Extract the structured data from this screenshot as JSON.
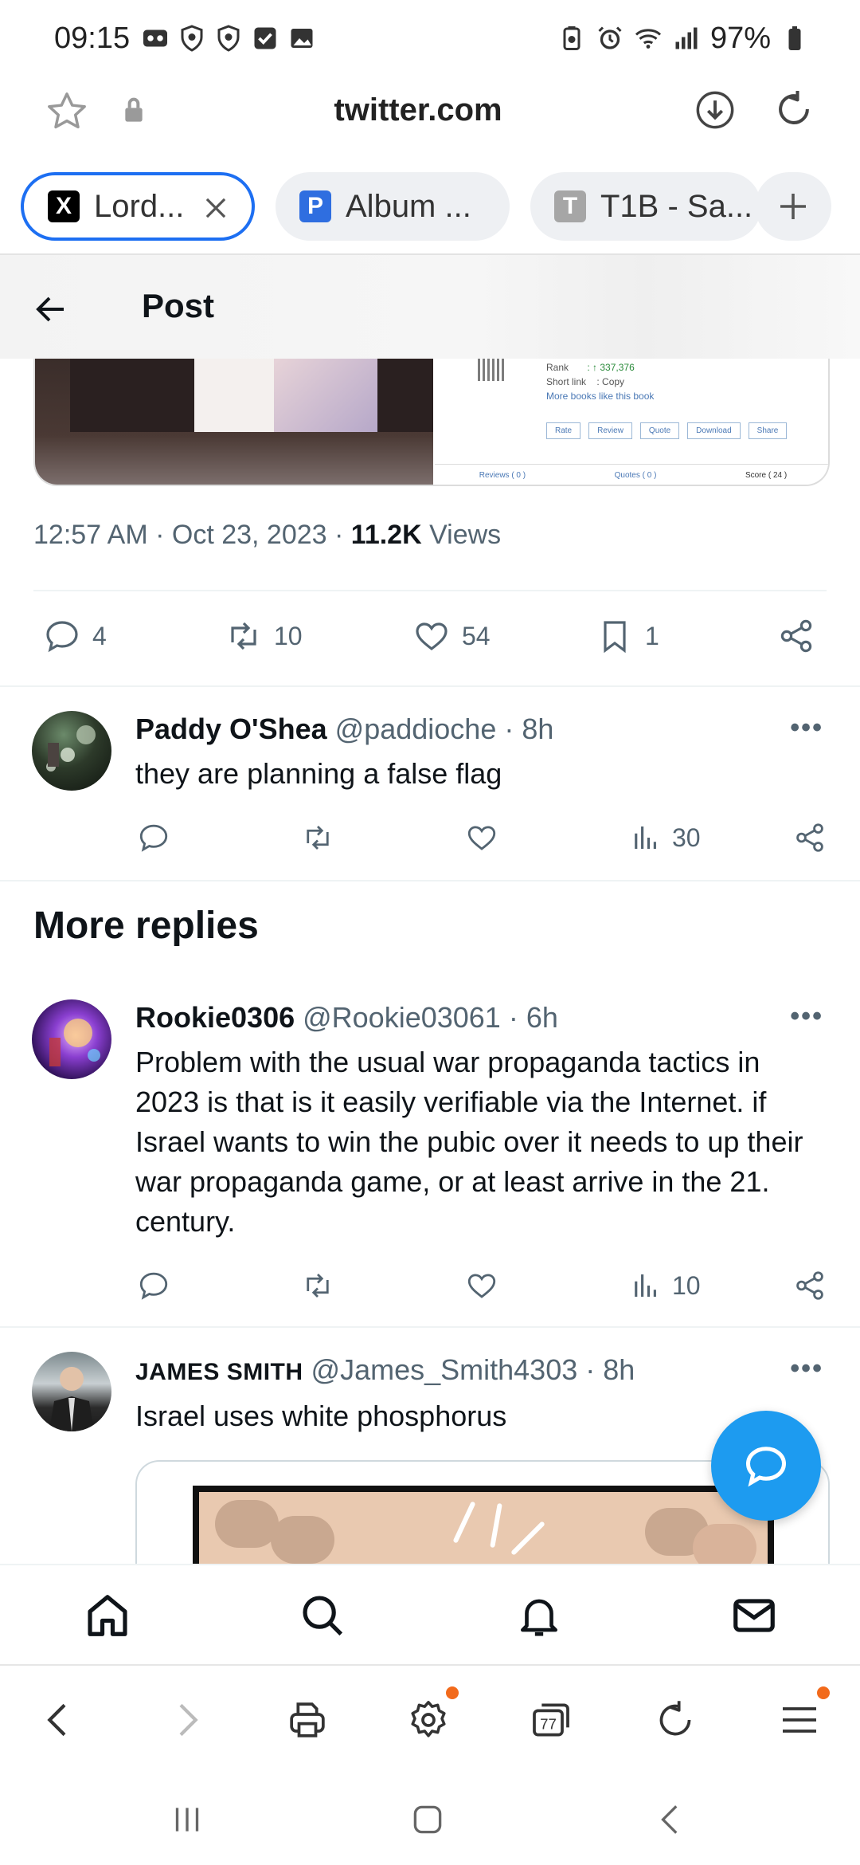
{
  "status_bar": {
    "time": "09:15",
    "battery": "97%"
  },
  "browser": {
    "url": "twitter.com",
    "tabs": [
      {
        "label": "Lord...",
        "favicon": "X",
        "active": true
      },
      {
        "label": "Album ...",
        "favicon": "P",
        "active": false
      },
      {
        "label": "T1B - Sa...",
        "favicon": "T",
        "active": false
      }
    ]
  },
  "post_header": {
    "title": "Post"
  },
  "media_preview": {
    "rank_label": "Rank",
    "rank_value": ": ↑ 337,376",
    "short_link_label": "Short link",
    "short_link_value": ": Copy",
    "more_books": "More books like this book",
    "buttons": [
      "Rate",
      "Review",
      "Quote",
      "Download",
      "Share"
    ],
    "footer": [
      "Reviews ( 0 )",
      "Quotes ( 0 )",
      "Score ( 24 )"
    ]
  },
  "main_tweet": {
    "timestamp": "12:57 AM · Oct 23, 2023 · ",
    "views_count": "11.2K",
    "views_label": " Views",
    "replies": "4",
    "retweets": "10",
    "likes": "54",
    "bookmarks": "1"
  },
  "replies": [
    {
      "name": "Paddy O'Shea",
      "handle": " @paddioche · 8h",
      "text": "they are planning a false flag",
      "views": "30"
    },
    {
      "name": "Rookie0306",
      "handle": " @Rookie03061 · 6h",
      "text": "Problem with the usual war propaganda tactics in 2023 is that is it easily verifiable via the Internet. if Israel wants to win the pubic over it needs to up their war propaganda game, or at least arrive in the 21. century.",
      "views": "10"
    },
    {
      "name": "JAMES SMITH",
      "handle": " @James_Smith4303 · 8h",
      "text": "Israel uses white phosphorus"
    }
  ],
  "section": {
    "more_replies": "More replies"
  },
  "more_menu": "•••",
  "browser_bottom": {
    "tab_count": "77"
  },
  "colors": {
    "accent": "#1d9bf0",
    "active_tab_border": "#1d6ff2",
    "muted_text": "#536471",
    "notification_dot": "#f26a1b"
  }
}
